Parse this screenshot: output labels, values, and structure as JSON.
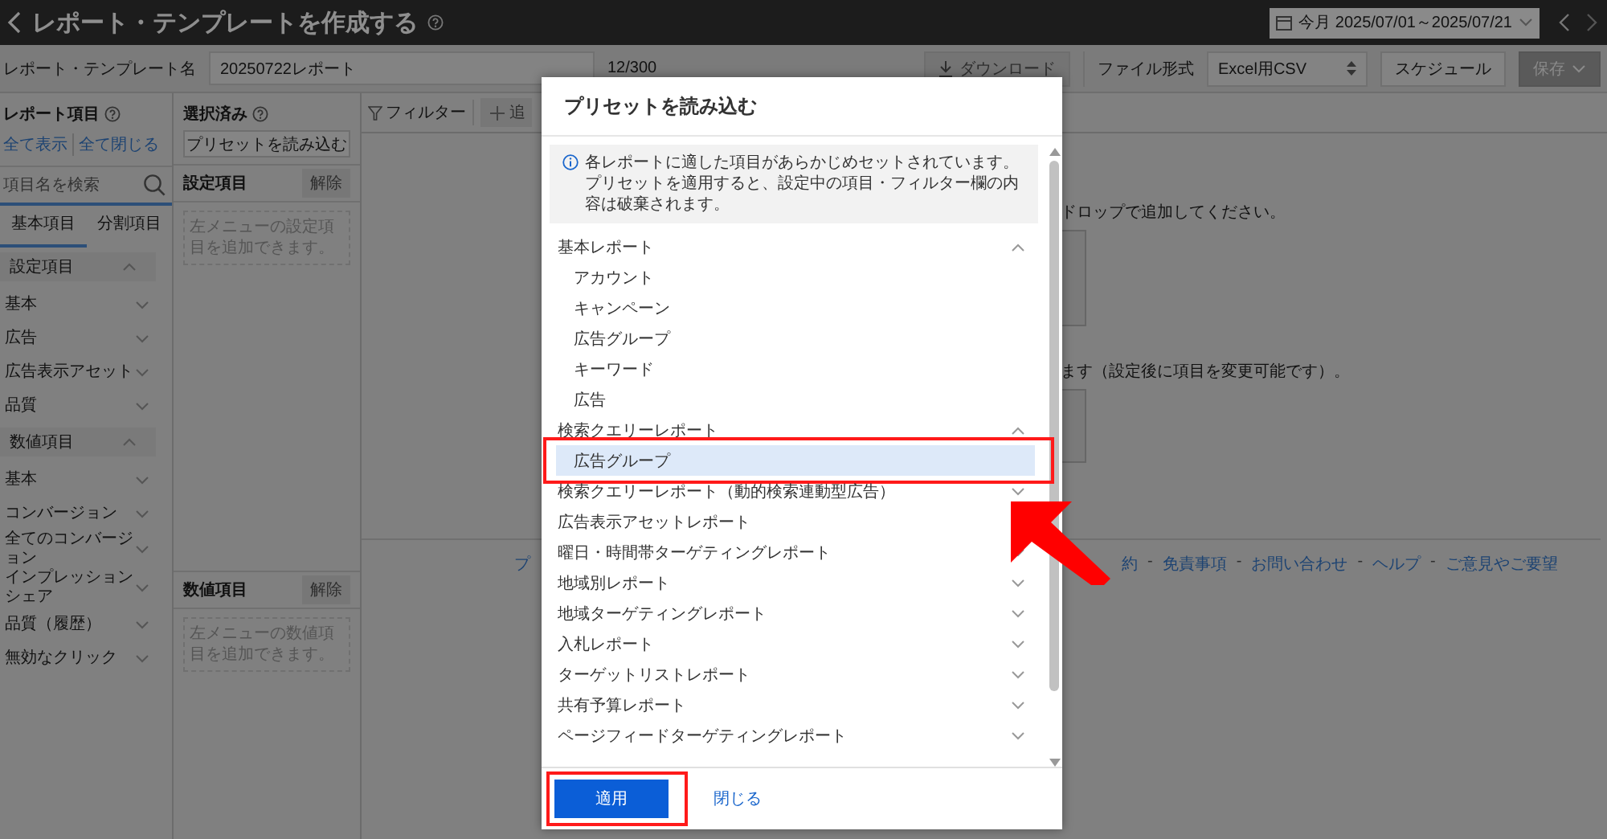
{
  "header": {
    "title": "レポート・テンプレートを作成する",
    "date_range": "今月 2025/07/01～2025/07/21"
  },
  "toolbar": {
    "name_label": "レポート・テンプレート名",
    "name_value": "20250722レポート",
    "char_count": "12/300",
    "download": "ダウンロード",
    "download_disabled": true,
    "format_label": "ファイル形式",
    "format_value": "Excel用CSV",
    "schedule": "スケジュール",
    "save": "保存"
  },
  "sidebar": {
    "title": "レポート項目",
    "show_all": "全て表示",
    "collapse_all": "全て閉じる",
    "search": {
      "placeholder": "項目名を検索"
    },
    "tabs": [
      {
        "label": "基本項目",
        "selected": true
      },
      {
        "label": "分割項目",
        "selected": false
      }
    ],
    "groups": [
      {
        "label": "設定項目",
        "expanded": true,
        "children": [
          {
            "label": "基本",
            "expanded": false
          },
          {
            "label": "広告",
            "expanded": false
          },
          {
            "label": "広告表示アセット",
            "expanded": false
          },
          {
            "label": "品質",
            "expanded": false
          }
        ]
      },
      {
        "label": "数値項目",
        "expanded": true,
        "children": [
          {
            "label": "基本",
            "expanded": false
          },
          {
            "label": "コンバージョン",
            "expanded": false
          },
          {
            "label": "全てのコンバージョン",
            "expanded": false
          },
          {
            "label": "インプレッションシェア",
            "expanded": false
          },
          {
            "label": "品質（履歴）",
            "expanded": false
          },
          {
            "label": "無効なクリック",
            "expanded": false
          }
        ]
      }
    ]
  },
  "selected": {
    "title": "選択済み",
    "preset_button": "プリセットを読み込む",
    "sections": [
      {
        "title": "設定項目",
        "clear": "解除",
        "hint": "左メニューの設定項目を追加できます。"
      },
      {
        "title": "数値項目",
        "clear": "解除",
        "hint": "左メニューの数値項目を追加できます。"
      }
    ]
  },
  "main": {
    "filter": "フィルター",
    "add": "追",
    "notes": [
      "ドロップで追加してください。",
      "ます（設定後に項目を変更可能です）。"
    ],
    "footer_left": "プ",
    "footer_links": [
      {
        "kind": "link",
        "text": "約"
      },
      {
        "kind": "separator",
        "text": "-"
      },
      {
        "kind": "link",
        "text": "免責事項"
      },
      {
        "kind": "separator",
        "text": "-"
      },
      {
        "kind": "link",
        "text": "お問い合わせ"
      },
      {
        "kind": "separator",
        "text": "-"
      },
      {
        "kind": "link",
        "text": "ヘルプ"
      },
      {
        "kind": "separator",
        "text": "-"
      },
      {
        "kind": "link",
        "text": "ご意見やご要望"
      }
    ]
  },
  "modal": {
    "title": "プリセットを読み込む",
    "info": [
      "各レポートに適した項目があらかじめセットされています。",
      "プリセットを適用すると、設定中の項目・フィルター欄の内容は破棄されます。"
    ],
    "groups": [
      {
        "label": "基本レポート",
        "expanded": true,
        "children": [
          {
            "label": "アカウント",
            "selected": false
          },
          {
            "label": "キャンペーン",
            "selected": false
          },
          {
            "label": "広告グループ",
            "selected": false
          },
          {
            "label": "キーワード",
            "selected": false
          },
          {
            "label": "広告",
            "selected": false
          }
        ]
      },
      {
        "label": "検索クエリーレポート",
        "expanded": true,
        "children": [
          {
            "label": "広告グループ",
            "selected": true
          }
        ]
      },
      {
        "label": "検索クエリーレポート（動的検索連動型広告）",
        "expanded": false
      },
      {
        "label": "広告表示アセットレポート"
      },
      {
        "label": "曜日・時間帯ターゲティングレポート",
        "expanded": false
      },
      {
        "label": "地域別レポート",
        "expanded": false
      },
      {
        "label": "地域ターゲティングレポート",
        "expanded": false
      },
      {
        "label": "入札レポート",
        "expanded": false
      },
      {
        "label": "ターゲットリストレポート",
        "expanded": false
      },
      {
        "label": "共有予算レポート",
        "expanded": false
      },
      {
        "label": "ページフィードターゲティングレポート",
        "expanded": false
      }
    ],
    "apply": "適用",
    "close": "閉じる"
  }
}
